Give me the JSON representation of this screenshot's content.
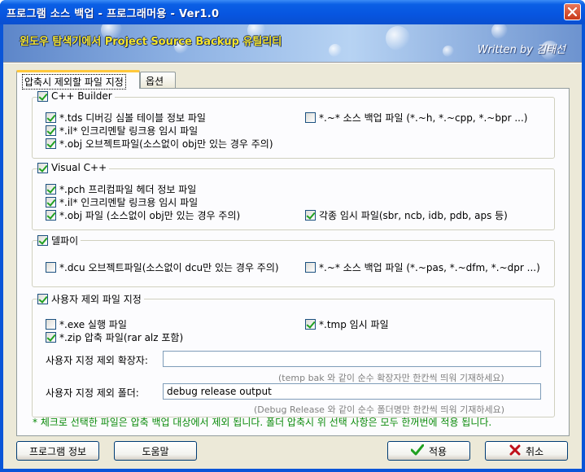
{
  "window": {
    "title": "프로그램 소스 백업 - 프로그래머용 - Ver1.0"
  },
  "banner": {
    "title": "윈도우 탐색기에서 Project Source Backup 유틸리티",
    "author": "Written by 김태선"
  },
  "tabs": [
    {
      "label": "압축시 제외할 파일 지정",
      "active": true
    },
    {
      "label": "옵션",
      "active": false
    }
  ],
  "groups": {
    "cpp_builder": {
      "label": "C++ Builder",
      "checked": true,
      "options": [
        {
          "label": "*.tds 디버깅 심볼 테이블 정보 파일",
          "checked": true
        },
        {
          "label": "*.~* 소스 백업 파일 (*.~h, *.~cpp, *.~bpr ...)",
          "checked": false
        },
        {
          "label": "*.il* 인크리멘탈 링크용 임시 파일",
          "checked": true
        },
        {
          "label": "*.obj 오브젝트파일(소스없이 obj만 있는 경우 주의)",
          "checked": true
        }
      ]
    },
    "visual_cpp": {
      "label": "Visual C++",
      "checked": true,
      "options": [
        {
          "label": "*.pch 프리컴파일 헤더 정보 파일",
          "checked": true
        },
        {
          "label": "*.il* 인크리멘탈 링크용 임시 파일",
          "checked": true
        },
        {
          "label": "*.obj 파일 (소스없이 obj만 있는 경우 주의)",
          "checked": true
        },
        {
          "label": "각종 임시 파일(sbr, ncb, idb, pdb, aps 등)",
          "checked": true
        }
      ]
    },
    "delphi": {
      "label": "델파이",
      "checked": true,
      "options": [
        {
          "label": "*.dcu 오브젝트파일(소스없이 dcu만 있는 경우 주의)",
          "checked": false
        },
        {
          "label": "*.~* 소스 백업 파일 (*.~pas, *.~dfm, *.~dpr ...)",
          "checked": false
        }
      ]
    },
    "user": {
      "label": "사용자 제외 파일 지정",
      "checked": true,
      "options": [
        {
          "label": "*.exe 실행 파일",
          "checked": false
        },
        {
          "label": "*.tmp 임시 파일",
          "checked": true
        },
        {
          "label": "*.zip 압축 파일(rar alz 포함)",
          "checked": true
        }
      ],
      "ext_label": "사용자 지정 제외 확장자:",
      "ext_value": "",
      "ext_hint": "(temp bak 와 같이 순수 확장자만 한칸씩 띄워 기재하세요)",
      "folder_label": "사용자 지정 제외 폴더:",
      "folder_value": "debug release output",
      "folder_hint": "(Debug Release 와 같이 순수 폴더명만 한칸씩 띄워 기재하세요)"
    }
  },
  "note": "* 체크로 선택한 파일은 압축 백업 대상에서 제외 됩니다. 폴더 압축시 위 선택 사항은 모두 한꺼번에 적용 됩니다.",
  "buttons": {
    "program_info": "프로그램 정보",
    "help": "도움말",
    "apply": "적용",
    "cancel": "취소"
  },
  "colors": {
    "title_bar": "#0a55d8",
    "banner_text": "#f7e62b",
    "note_text": "#0a8a0a",
    "check_mark": "#21a121",
    "cancel_x": "#c0101a"
  },
  "icons": {
    "close": "close-icon",
    "apply": "check-icon",
    "cancel": "x-icon"
  }
}
